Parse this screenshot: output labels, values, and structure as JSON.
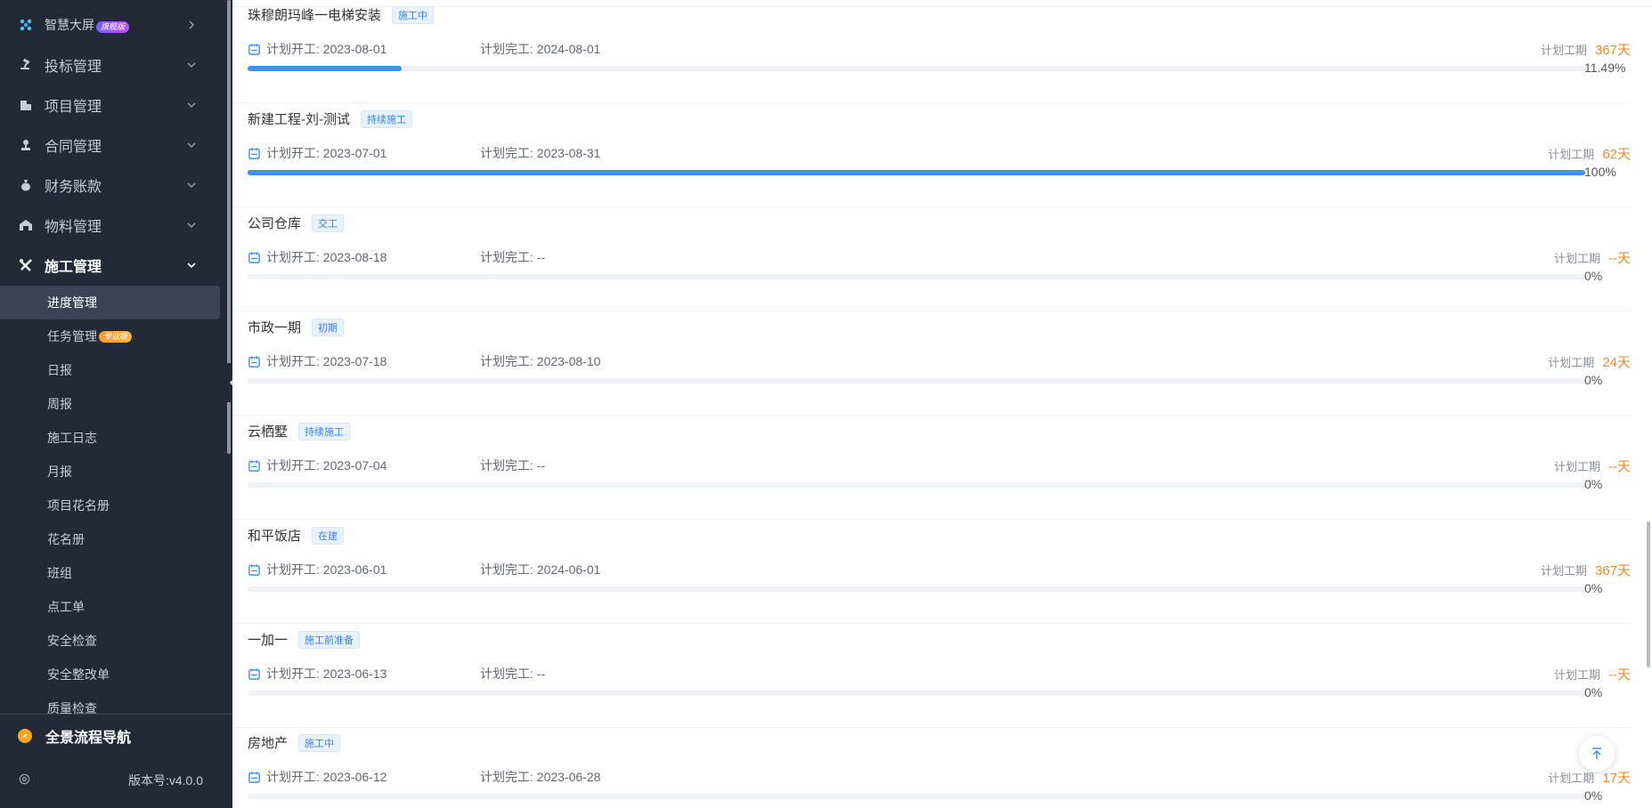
{
  "sidebar": {
    "menu": [
      {
        "label": "智慧大屏",
        "icon": "dashboard-icon",
        "badge": "旗舰版"
      },
      {
        "label": "投标管理",
        "icon": "gavel-icon"
      },
      {
        "label": "项目管理",
        "icon": "building-icon"
      },
      {
        "label": "合同管理",
        "icon": "seal-icon"
      },
      {
        "label": "财务账款",
        "icon": "money-bag-icon"
      },
      {
        "label": "物料管理",
        "icon": "warehouse-icon"
      },
      {
        "label": "施工管理",
        "icon": "tools-icon"
      }
    ],
    "submenu": [
      {
        "label": "进度管理"
      },
      {
        "label": "任务管理",
        "badge": "专业版"
      },
      {
        "label": "日报"
      },
      {
        "label": "周报"
      },
      {
        "label": "施工日志"
      },
      {
        "label": "月报"
      },
      {
        "label": "项目花名册"
      },
      {
        "label": "花名册"
      },
      {
        "label": "班组"
      },
      {
        "label": "点工单"
      },
      {
        "label": "安全检查"
      },
      {
        "label": "安全整改单"
      },
      {
        "label": "质量检查"
      }
    ],
    "guide_label": "全景流程导航",
    "version_label": "版本号:v4.0.0"
  },
  "colors": {
    "sidebar_bg": "#222a37",
    "accent": "#3d92ee",
    "days": "#f08c28",
    "tag": "#3b82f6"
  },
  "labels": {
    "start": "计划开工: ",
    "end": "计划完工: ",
    "duration": "计划工期"
  },
  "projects": [
    {
      "name": "珠穆朗玛峰一电梯安装",
      "tag": "施工中",
      "start": "计划开工: 2023-08-01",
      "end": "计划完工: 2024-08-01",
      "duration_label": "计划工期",
      "days": "367天",
      "progress": 11.49,
      "pct": "11.49%"
    },
    {
      "name": "新建工程-刘-测试",
      "tag": "持续施工",
      "start": "计划开工: 2023-07-01",
      "end": "计划完工: 2023-08-31",
      "duration_label": "计划工期",
      "days": "62天",
      "progress": 100,
      "pct": "100%"
    },
    {
      "name": "公司仓库",
      "tag": "交工",
      "start": "计划开工: 2023-08-18",
      "end": "计划完工: --",
      "duration_label": "计划工期",
      "days": "--天",
      "progress": 0,
      "pct": "0%"
    },
    {
      "name": "市政一期",
      "tag": "初期",
      "start": "计划开工: 2023-07-18",
      "end": "计划完工: 2023-08-10",
      "duration_label": "计划工期",
      "days": "24天",
      "progress": 0,
      "pct": "0%"
    },
    {
      "name": "云栖墅",
      "tag": "持续施工",
      "start": "计划开工: 2023-07-04",
      "end": "计划完工: --",
      "duration_label": "计划工期",
      "days": "--天",
      "progress": 0,
      "pct": "0%"
    },
    {
      "name": "和平饭店",
      "tag": "在建",
      "start": "计划开工: 2023-06-01",
      "end": "计划完工: 2024-06-01",
      "duration_label": "计划工期",
      "days": "367天",
      "progress": 0,
      "pct": "0%"
    },
    {
      "name": "一加一",
      "tag": "施工前准备",
      "start": "计划开工: 2023-06-13",
      "end": "计划完工: --",
      "duration_label": "计划工期",
      "days": "--天",
      "progress": 0,
      "pct": "0%"
    },
    {
      "name": "房地产",
      "tag": "施工中",
      "start": "计划开工: 2023-06-12",
      "end": "计划完工: 2023-06-28",
      "duration_label": "计划工期",
      "days": "17天",
      "progress": 0,
      "pct": "0%"
    }
  ]
}
